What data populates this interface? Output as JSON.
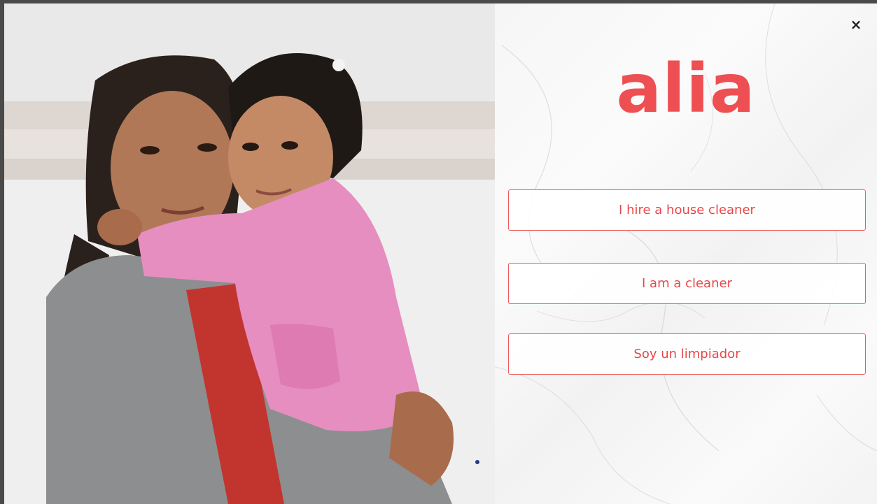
{
  "brand": {
    "logo_text": "alia",
    "accent_color": "#ee4f52"
  },
  "dialog": {
    "close_icon": "close-icon",
    "close_glyph": "×"
  },
  "choices": [
    {
      "label": "I hire a house cleaner"
    },
    {
      "label": "I am a cleaner"
    },
    {
      "label": "Soy un limpiador"
    }
  ],
  "photo": {
    "subject": "photo"
  }
}
